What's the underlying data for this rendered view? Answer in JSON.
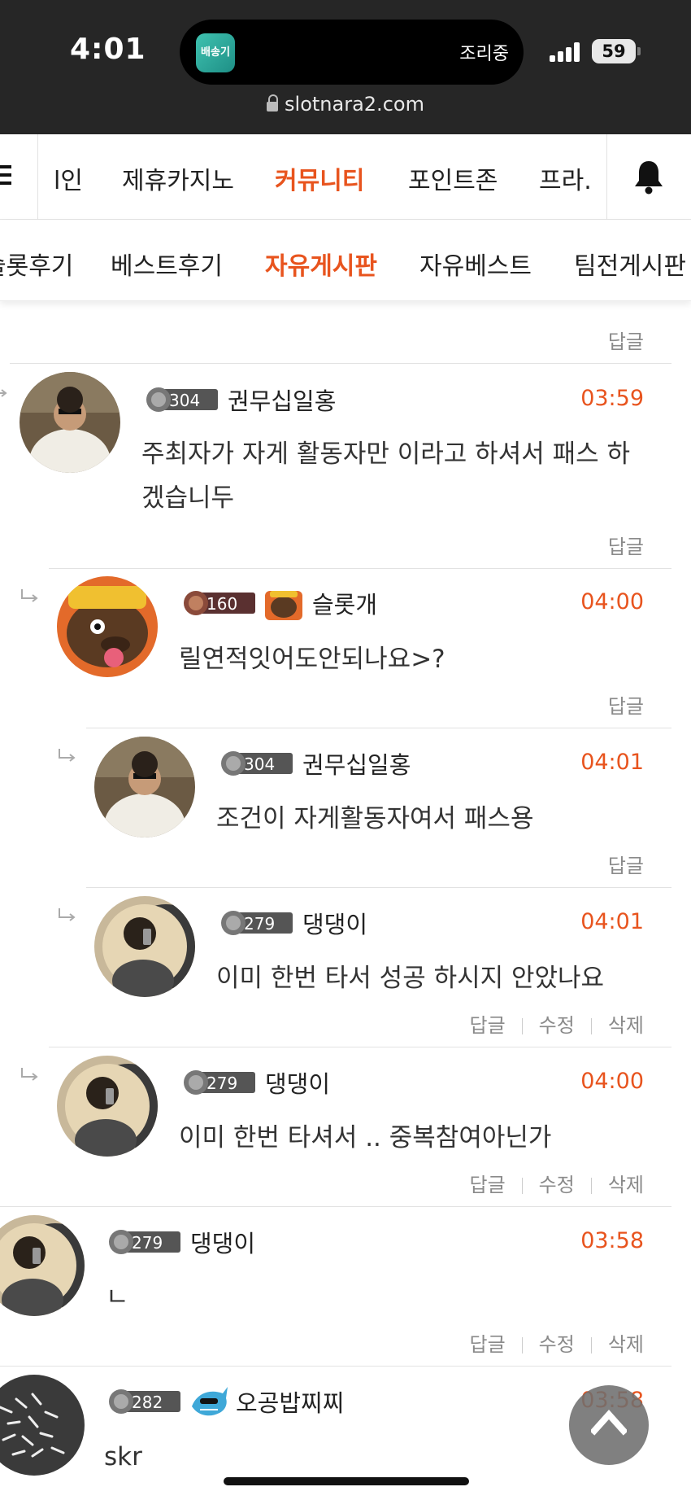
{
  "status_bar": {
    "time": "4:01",
    "island_app_label": "배송기",
    "island_status": "조리중",
    "battery": "59",
    "url": "slotnara2.com"
  },
  "main_nav": {
    "items": [
      "l인",
      "제휴카지노",
      "커뮤니티",
      "포인트존",
      "프라."
    ],
    "active": "커뮤니티"
  },
  "sub_nav": {
    "items": [
      "슬롯후기",
      "베스트후기",
      "자유게시판",
      "자유베스트",
      "팀전게시판"
    ],
    "active": "자유게시판"
  },
  "actions": {
    "reply": "답글",
    "edit": "수정",
    "delete": "삭제"
  },
  "comments": [
    {
      "level": "304",
      "nickname": "권무십일홍",
      "time": "03:59",
      "text": "주최자가 자게 활동자만 이라고 하셔서 패스 하겠습니두",
      "owner": false
    },
    {
      "level": "160",
      "nickname": "슬롯개",
      "time": "04:00",
      "text": "릴연적잇어도안되나요>?",
      "owner": false
    },
    {
      "level": "304",
      "nickname": "권무십일홍",
      "time": "04:01",
      "text": "조건이 자게활동자여서 패스용",
      "owner": false
    },
    {
      "level": "279",
      "nickname": "댕댕이",
      "time": "04:01",
      "text": "이미 한번 타서 성공 하시지 안았나요",
      "owner": true
    },
    {
      "level": "279",
      "nickname": "댕댕이",
      "time": "04:00",
      "text": "이미 한번 타셔서 .. 중복참여아닌가",
      "owner": true
    },
    {
      "level": "279",
      "nickname": "댕댕이",
      "time": "03:58",
      "text": "ㄴ",
      "owner": true
    },
    {
      "level": "282",
      "nickname": "오공밥찌찌",
      "time": "03:58",
      "text": "skr",
      "owner": false
    }
  ],
  "colors": {
    "accent": "#e8541e",
    "status_bar_bg": "#262626",
    "muted_text": "#8a8a8a"
  }
}
